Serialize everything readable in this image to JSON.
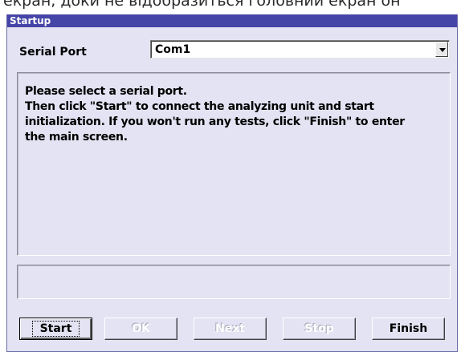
{
  "caption": "екран, доки не відобразиться головний екран он",
  "window": {
    "title": "Startup"
  },
  "serial_port": {
    "label": "Serial Port",
    "value": "Com1"
  },
  "info": {
    "lines": [
      "Please select a serial port.",
      "Then click \"Start\" to connect the analyzing unit and start",
      "initialization. If you won't run any tests, click \"Finish\" to enter",
      "the main screen."
    ]
  },
  "status": {
    "text": ""
  },
  "buttons": {
    "start": "Start",
    "ok": "OK",
    "next": "Next",
    "stop": "Stop",
    "finish": "Finish"
  },
  "colors": {
    "titlebar": "#4545a8",
    "dialog_bg": "#e3e3f3"
  }
}
